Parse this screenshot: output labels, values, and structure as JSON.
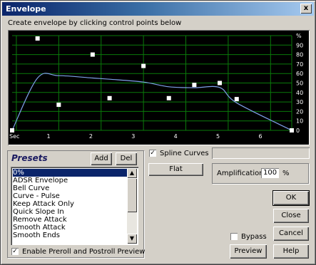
{
  "window": {
    "title": "Envelope",
    "close_glyph": "x"
  },
  "instruction": "Create envelope by clicking control points below",
  "graph": {
    "y_axis_labels": [
      "%",
      "90",
      "80",
      "70",
      "60",
      "50",
      "40",
      "30",
      "20",
      "10",
      "0"
    ],
    "x_axis_labels": [
      "Sec",
      "1",
      "2",
      "3",
      "4",
      "5",
      "6"
    ],
    "control_points": [
      {
        "t": 0.0,
        "v": 0
      },
      {
        "t": 0.6,
        "v": 97
      },
      {
        "t": 1.1,
        "v": 27
      },
      {
        "t": 1.9,
        "v": 80
      },
      {
        "t": 2.3,
        "v": 34
      },
      {
        "t": 3.1,
        "v": 68
      },
      {
        "t": 3.7,
        "v": 34
      },
      {
        "t": 4.3,
        "v": 48
      },
      {
        "t": 4.9,
        "v": 50
      },
      {
        "t": 5.3,
        "v": 33
      },
      {
        "t": 6.6,
        "v": 0
      }
    ],
    "colors": {
      "background": "#000000",
      "grid": "#0a7a0a",
      "curve": "#7ea0e8",
      "points": "#ffffff",
      "labels": "#ffffff"
    }
  },
  "presets": {
    "label": "Presets",
    "add_label": "Add",
    "del_label": "Del",
    "items": [
      "0%",
      "ADSR Envelope",
      "Bell Curve",
      "Curve - Pulse",
      "Keep Attack Only",
      "Quick Slope In",
      "Remove Attack",
      "Smooth Attack",
      "Smooth Ends"
    ],
    "selected_index": 0
  },
  "spline": {
    "label": "Spline Curves",
    "checked": true
  },
  "flat_label": "Flat",
  "amplification": {
    "label": "Amplification",
    "value": "100",
    "unit": "%"
  },
  "preroll": {
    "label": "Enable Preroll and Postroll Preview",
    "checked": true
  },
  "buttons": {
    "ok": "OK",
    "close": "Close",
    "cancel": "Cancel",
    "preview": "Preview",
    "help": "Help"
  },
  "bypass": {
    "label": "Bypass",
    "checked": false
  }
}
